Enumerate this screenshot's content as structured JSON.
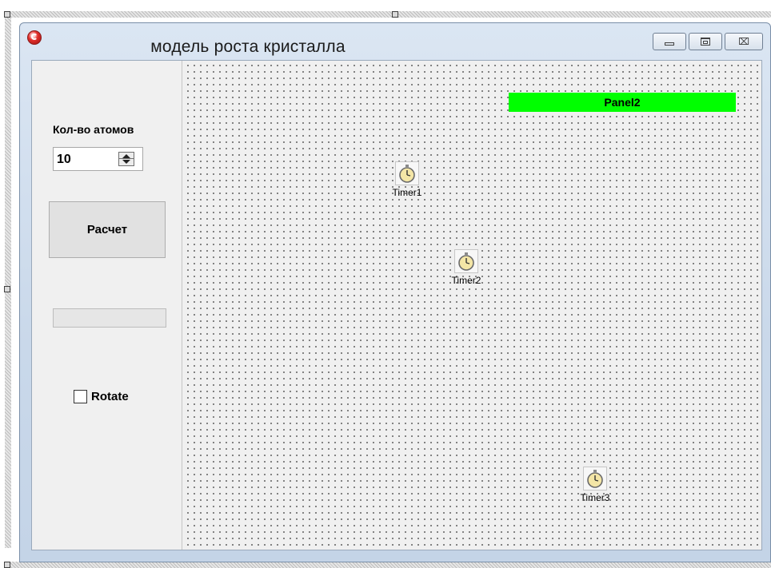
{
  "window": {
    "title": "модель роста кристалла",
    "icon": "app-icon",
    "controls": {
      "minimize": "minimize-icon",
      "maximize": "maximize-icon",
      "close_glyph": "⌧"
    }
  },
  "left_panel": {
    "atoms_label": "Кол-во атомов",
    "atoms_value": "10",
    "calc_button": "Расчет",
    "progress_value": 0,
    "rotate_label": "Rotate",
    "rotate_checked": false
  },
  "canvas": {
    "panel2": {
      "label": "Panel2",
      "color": "#00ff00"
    },
    "timers": [
      {
        "label": "Timer1",
        "icon": "stopwatch-icon"
      },
      {
        "label": "Timer2",
        "icon": "stopwatch-icon"
      },
      {
        "label": "Timer3",
        "icon": "stopwatch-icon"
      }
    ]
  }
}
